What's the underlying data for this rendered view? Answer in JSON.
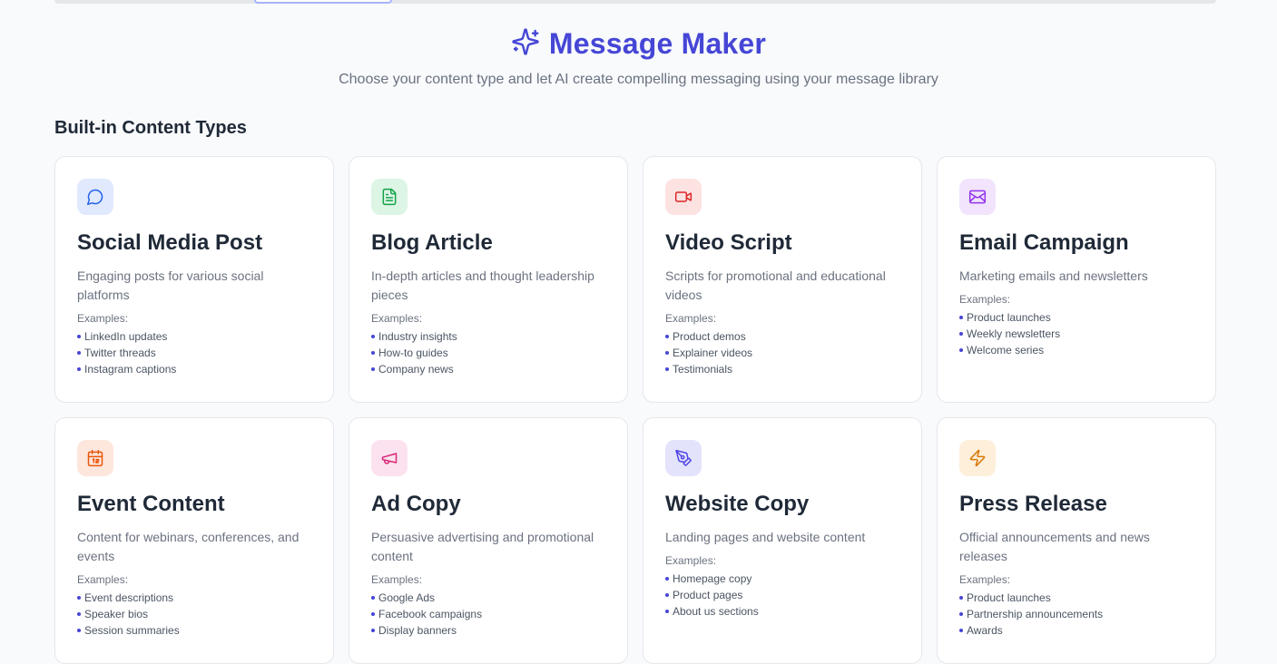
{
  "header": {
    "title": "Message Maker",
    "subtitle": "Choose your content type and let AI create compelling messaging using your message library",
    "icon": "sparkles-icon",
    "accent_color": "#4646d6"
  },
  "section": {
    "title": "Built-in Content Types"
  },
  "examples_label": "Examples:",
  "cards": [
    {
      "id": "social-media-post",
      "icon": "message-circle-icon",
      "icon_color": "#2563eb",
      "icon_bg": "#e0e9fd",
      "title": "Social Media Post",
      "description": "Engaging posts for various social platforms",
      "examples": [
        "LinkedIn updates",
        "Twitter threads",
        "Instagram captions"
      ]
    },
    {
      "id": "blog-article",
      "icon": "file-text-icon",
      "icon_color": "#16a34a",
      "icon_bg": "#dcf5e5",
      "title": "Blog Article",
      "description": "In-depth articles and thought leadership pieces",
      "examples": [
        "Industry insights",
        "How-to guides",
        "Company news"
      ]
    },
    {
      "id": "video-script",
      "icon": "video-icon",
      "icon_color": "#dc2626",
      "icon_bg": "#fde2e2",
      "title": "Video Script",
      "description": "Scripts for promotional and educational videos",
      "examples": [
        "Product demos",
        "Explainer videos",
        "Testimonials"
      ]
    },
    {
      "id": "email-campaign",
      "icon": "mail-icon",
      "icon_color": "#9333ea",
      "icon_bg": "#f1e4fc",
      "title": "Email Campaign",
      "description": "Marketing emails and newsletters",
      "examples": [
        "Product launches",
        "Weekly newsletters",
        "Welcome series"
      ]
    },
    {
      "id": "event-content",
      "icon": "calendar-icon",
      "icon_color": "#ea580c",
      "icon_bg": "#fde6dc",
      "title": "Event Content",
      "description": "Content for webinars, conferences, and events",
      "examples": [
        "Event descriptions",
        "Speaker bios",
        "Session summaries"
      ]
    },
    {
      "id": "ad-copy",
      "icon": "megaphone-icon",
      "icon_color": "#db2777",
      "icon_bg": "#fce2ef",
      "title": "Ad Copy",
      "description": "Persuasive advertising and promotional content",
      "examples": [
        "Google Ads",
        "Facebook campaigns",
        "Display banners"
      ]
    },
    {
      "id": "website-copy",
      "icon": "pen-tool-icon",
      "icon_color": "#4f46e5",
      "icon_bg": "#e3e3fb",
      "title": "Website Copy",
      "description": "Landing pages and website content",
      "examples": [
        "Homepage copy",
        "Product pages",
        "About us sections"
      ]
    },
    {
      "id": "press-release",
      "icon": "zap-icon",
      "icon_color": "#d97706",
      "icon_bg": "#fdefd9",
      "title": "Press Release",
      "description": "Official announcements and news releases",
      "examples": [
        "Product launches",
        "Partnership announcements",
        "Awards"
      ]
    }
  ]
}
